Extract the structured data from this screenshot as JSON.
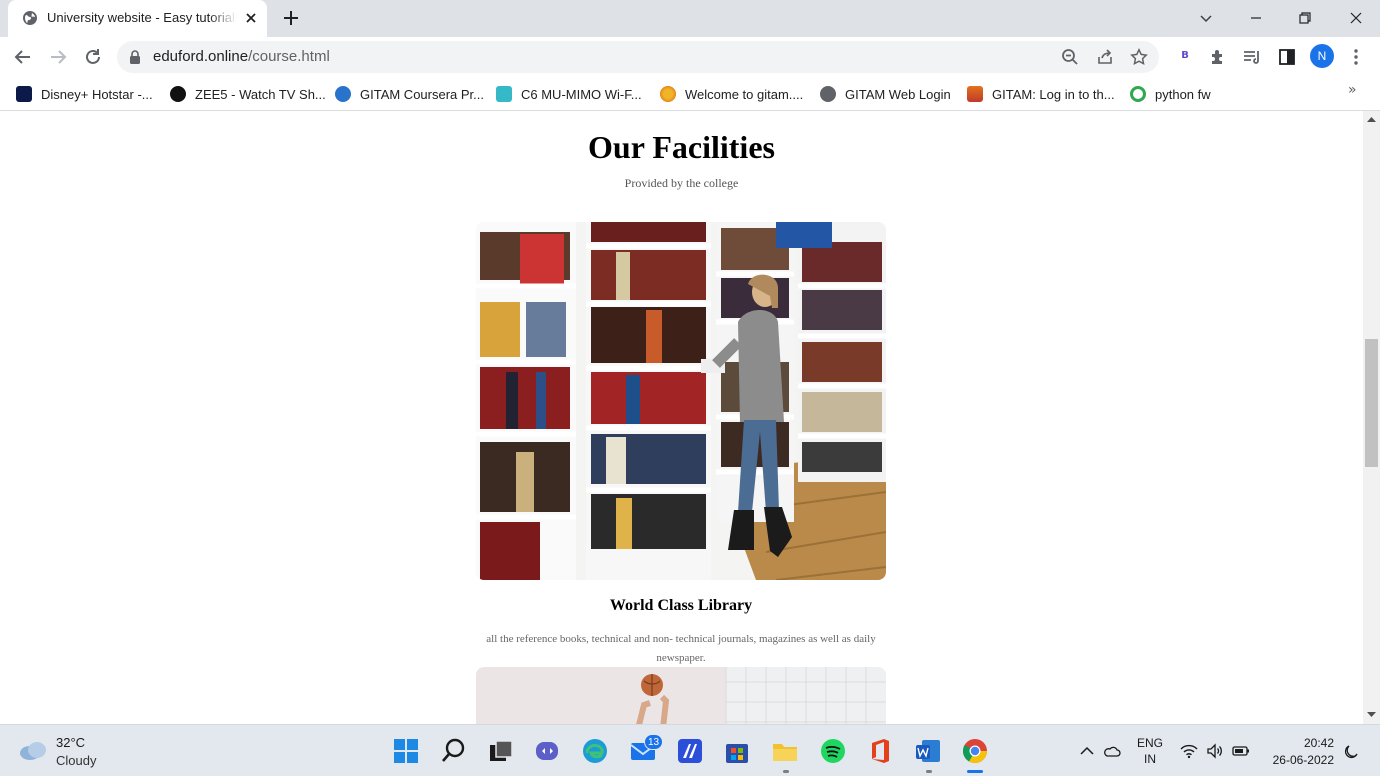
{
  "browser": {
    "tab_title": "University website - Easy tutorials",
    "url_domain": "eduford.online",
    "url_path": "/course.html",
    "profile_initial": "N",
    "extension_label": "B"
  },
  "bookmarks": [
    {
      "label": "Disney+ Hotstar -...",
      "icon": "hotstar-icon",
      "color": "#0c1a4a"
    },
    {
      "label": "ZEE5 - Watch TV Sh...",
      "icon": "zee5-icon",
      "color": "#111111"
    },
    {
      "label": "GITAM Coursera Pr...",
      "icon": "coursera-icon",
      "color": "#2a73cc"
    },
    {
      "label": "C6 MU-MIMO Wi-F...",
      "icon": "tplink-icon",
      "color": "#35b9c9"
    },
    {
      "label": "Welcome to gitam....",
      "icon": "gitam-sun-icon",
      "color": "#e38a1b"
    },
    {
      "label": "GITAM Web Login",
      "icon": "globe-icon",
      "color": "#5f6368"
    },
    {
      "label": "GITAM: Log in to th...",
      "icon": "gitam-logo-icon",
      "color": "#e2721b"
    },
    {
      "label": "python fw",
      "icon": "python-fw-icon",
      "color": "#2fa84f"
    }
  ],
  "page": {
    "heading": "Our Facilities",
    "subheading": "Provided by the college",
    "cards": [
      {
        "title": "World Class Library",
        "description": "all the reference books, technical and non- technical journals, magazines as well as daily newspaper."
      }
    ]
  },
  "taskbar": {
    "weather_temp": "32°C",
    "weather_desc": "Cloudy",
    "mail_badge": "13",
    "lang_1": "ENG",
    "lang_2": "IN",
    "time": "20:42",
    "date": "26-06-2022"
  }
}
